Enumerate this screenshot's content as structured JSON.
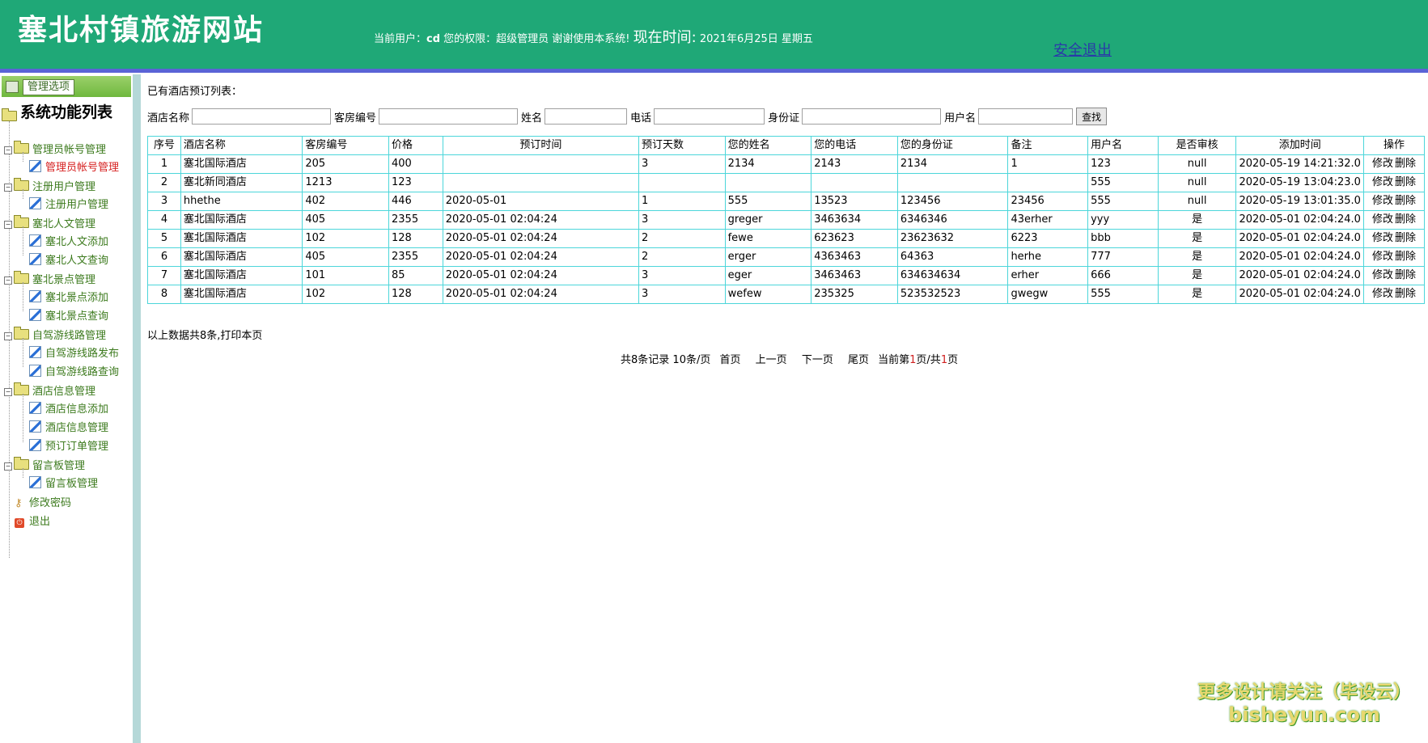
{
  "header": {
    "site_title": "塞北村镇旅游网站",
    "current_user_label": "当前用户：",
    "username": "cd",
    "role_text": "您的权限：超级管理员 谢谢使用本系统!",
    "now_label": "现在时间:",
    "now_value": "2021年6月25日 星期五",
    "logout": "安全退出"
  },
  "sidebar": {
    "header_label": "管理选项",
    "root_label": "系统功能列表",
    "groups": [
      {
        "label": "管理员帐号管理",
        "items": [
          "管理员帐号管理"
        ]
      },
      {
        "label": "注册用户管理",
        "items": [
          "注册用户管理"
        ]
      },
      {
        "label": "塞北人文管理",
        "items": [
          "塞北人文添加",
          "塞北人文查询"
        ]
      },
      {
        "label": "塞北景点管理",
        "items": [
          "塞北景点添加",
          "塞北景点查询"
        ]
      },
      {
        "label": "自驾游线路管理",
        "items": [
          "自驾游线路发布",
          "自驾游线路查询"
        ]
      },
      {
        "label": "酒店信息管理",
        "items": [
          "酒店信息添加",
          "酒店信息管理",
          "预订订单管理"
        ]
      },
      {
        "label": "留言板管理",
        "items": [
          "留言板管理"
        ]
      }
    ],
    "change_password": "修改密码",
    "exit": "退出"
  },
  "main": {
    "section_title": "已有酒店预订列表：",
    "search": {
      "hotel_label": "酒店名称",
      "room_label": "客房编号",
      "name_label": "姓名",
      "phone_label": "电话",
      "idcard_label": "身份证",
      "user_label": "用户名",
      "submit": "查找"
    },
    "table": {
      "headers": [
        "序号",
        "酒店名称",
        "客房编号",
        "价格",
        "预订时间",
        "预订天数",
        "您的姓名",
        "您的电话",
        "您的身份证",
        "备注",
        "用户名",
        "是否审核",
        "添加时间",
        "操作"
      ],
      "rows": [
        [
          "1",
          "塞北国际酒店",
          "205",
          "400",
          "",
          "3",
          "2134",
          "2143",
          "2134",
          "1",
          "123",
          "null",
          "2020-05-19 14:21:32.0"
        ],
        [
          "2",
          "塞北新同酒店",
          "1213",
          "123",
          "",
          "",
          "",
          "",
          "",
          "",
          "555",
          "null",
          "2020-05-19 13:04:23.0"
        ],
        [
          "3",
          "hhethe",
          "402",
          "446",
          "2020-05-01",
          "1",
          "555",
          "13523",
          "123456",
          "23456",
          "555",
          "null",
          "2020-05-19 13:01:35.0"
        ],
        [
          "4",
          "塞北国际酒店",
          "405",
          "2355",
          "2020-05-01 02:04:24",
          "3",
          "greger",
          "3463634",
          "6346346",
          "43erher",
          "yyy",
          "是",
          "2020-05-01 02:04:24.0"
        ],
        [
          "5",
          "塞北国际酒店",
          "102",
          "128",
          "2020-05-01 02:04:24",
          "2",
          "fewe",
          "623623",
          "23623632",
          "6223",
          "bbb",
          "是",
          "2020-05-01 02:04:24.0"
        ],
        [
          "6",
          "塞北国际酒店",
          "405",
          "2355",
          "2020-05-01 02:04:24",
          "2",
          "erger",
          "4363463",
          "64363",
          "herhe",
          "777",
          "是",
          "2020-05-01 02:04:24.0"
        ],
        [
          "7",
          "塞北国际酒店",
          "101",
          "85",
          "2020-05-01 02:04:24",
          "3",
          "eger",
          "3463463",
          "634634634",
          "erher",
          "666",
          "是",
          "2020-05-01 02:04:24.0"
        ],
        [
          "8",
          "塞北国际酒店",
          "102",
          "128",
          "2020-05-01 02:04:24",
          "3",
          "wefew",
          "235325",
          "523532523",
          "gwegw",
          "555",
          "是",
          "2020-05-01 02:04:24.0"
        ]
      ],
      "edit_label": "修改",
      "delete_label": "删除"
    },
    "summary": "以上数据共8条,打印本页",
    "pager": {
      "total": "共8条记录",
      "per_page": "10条/页",
      "first": "首页",
      "prev": "上一页",
      "next": "下一页",
      "last": "尾页",
      "current_prefix": "当前第",
      "current_page": "1",
      "current_mid": "页/共",
      "total_pages": "1",
      "current_suffix": "页"
    }
  },
  "watermark": {
    "line1": "更多设计请关注（毕设云）",
    "line2": "bisheyun.com"
  },
  "colors": {
    "header_bg": "#1fa877",
    "accent_stripe": "#5a63d6",
    "table_border": "#4cd6da",
    "tree_text": "#3c7a1d",
    "active_text": "#d62020"
  }
}
